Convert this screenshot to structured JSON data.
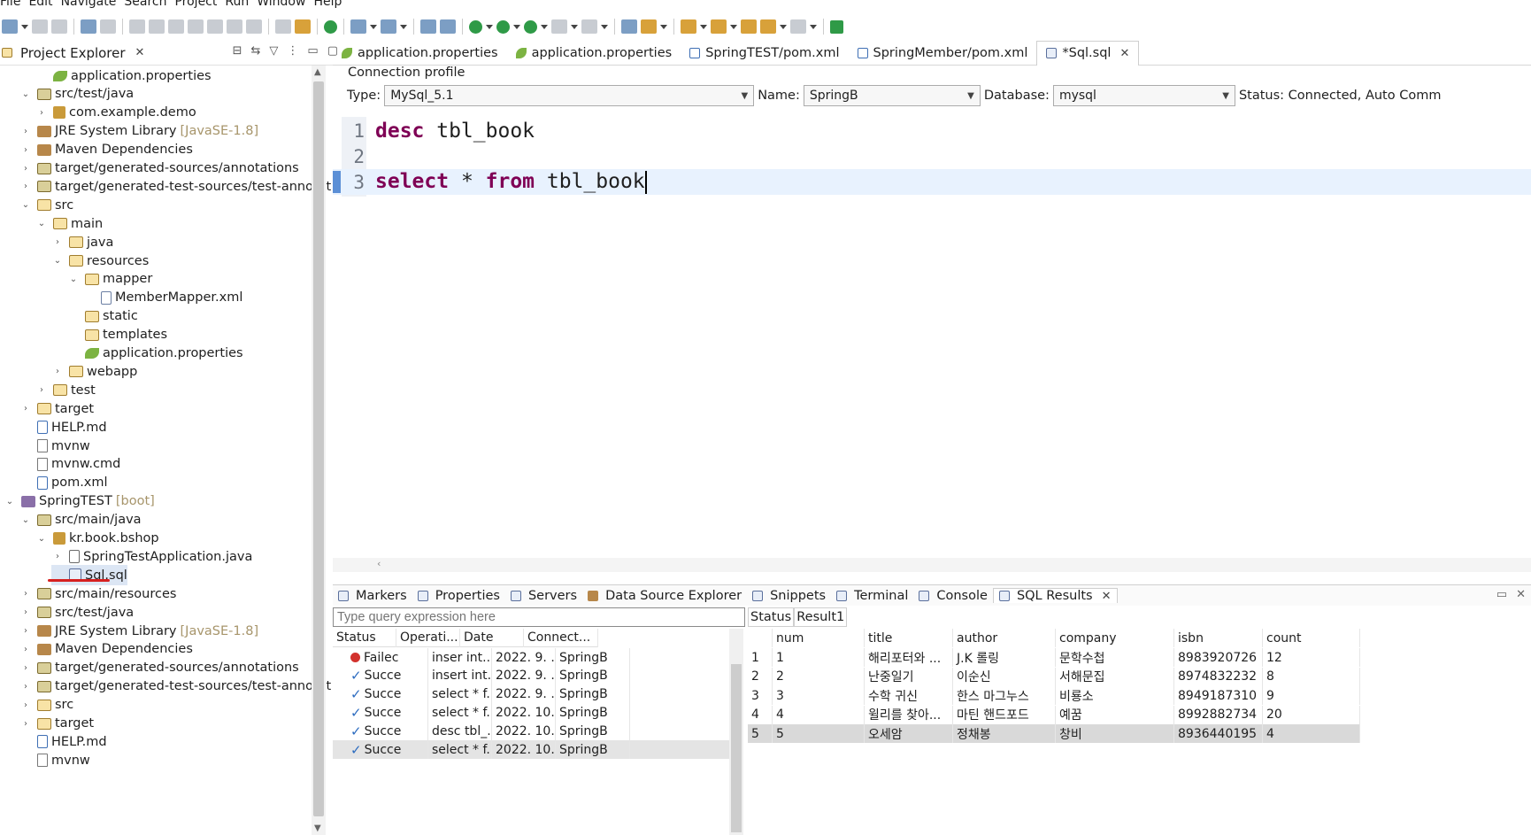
{
  "menu": [
    "File",
    "Edit",
    "Navigate",
    "Search",
    "Project",
    "Run",
    "Window",
    "Help"
  ],
  "project_explorer": {
    "title": "Project Explorer",
    "items": [
      {
        "label": "application.properties",
        "indent": 2,
        "twisty": "",
        "icon": "leaf"
      },
      {
        "label": "src/test/java",
        "indent": 1,
        "twisty": "v",
        "icon": "srcf"
      },
      {
        "label": "com.example.demo",
        "indent": 2,
        "twisty": ">",
        "icon": "pkg"
      },
      {
        "label": "JRE System Library",
        "suffix": "[JavaSE-1.8]",
        "indent": 1,
        "twisty": ">",
        "icon": "lib"
      },
      {
        "label": "Maven Dependencies",
        "indent": 1,
        "twisty": ">",
        "icon": "lib"
      },
      {
        "label": "target/generated-sources/annotations",
        "indent": 1,
        "twisty": ">",
        "icon": "srcf"
      },
      {
        "label": "target/generated-test-sources/test-annotations",
        "indent": 1,
        "twisty": ">",
        "icon": "srcf"
      },
      {
        "label": "src",
        "indent": 1,
        "twisty": "v",
        "icon": "folder"
      },
      {
        "label": "main",
        "indent": 2,
        "twisty": "v",
        "icon": "folder"
      },
      {
        "label": "java",
        "indent": 3,
        "twisty": ">",
        "icon": "folder"
      },
      {
        "label": "resources",
        "indent": 3,
        "twisty": "v",
        "icon": "folder"
      },
      {
        "label": "mapper",
        "indent": 4,
        "twisty": "v",
        "icon": "folder"
      },
      {
        "label": "MemberMapper.xml",
        "indent": 5,
        "twisty": "",
        "icon": "xml"
      },
      {
        "label": "static",
        "indent": 4,
        "twisty": "",
        "icon": "folder"
      },
      {
        "label": "templates",
        "indent": 4,
        "twisty": "",
        "icon": "folder"
      },
      {
        "label": "application.properties",
        "indent": 4,
        "twisty": "",
        "icon": "leaf"
      },
      {
        "label": "webapp",
        "indent": 3,
        "twisty": ">",
        "icon": "folder"
      },
      {
        "label": "test",
        "indent": 2,
        "twisty": ">",
        "icon": "folder"
      },
      {
        "label": "target",
        "indent": 1,
        "twisty": ">",
        "icon": "folder"
      },
      {
        "label": "HELP.md",
        "indent": 1,
        "twisty": "",
        "icon": "md"
      },
      {
        "label": "mvnw",
        "indent": 1,
        "twisty": "",
        "icon": "file"
      },
      {
        "label": "mvnw.cmd",
        "indent": 1,
        "twisty": "",
        "icon": "file"
      },
      {
        "label": "pom.xml",
        "indent": 1,
        "twisty": "",
        "icon": "md"
      },
      {
        "label": "SpringTEST",
        "suffix": "[boot]",
        "indent": 0,
        "twisty": "v",
        "icon": "proj"
      },
      {
        "label": "src/main/java",
        "indent": 1,
        "twisty": "v",
        "icon": "srcf"
      },
      {
        "label": "kr.book.bshop",
        "indent": 2,
        "twisty": "v",
        "icon": "pkg"
      },
      {
        "label": "SpringTestApplication.java",
        "indent": 3,
        "twisty": ">",
        "icon": "java"
      },
      {
        "label": "Sql.sql",
        "indent": 3,
        "twisty": "",
        "icon": "sql",
        "selected": true
      },
      {
        "label": "src/main/resources",
        "indent": 1,
        "twisty": ">",
        "icon": "srcf"
      },
      {
        "label": "src/test/java",
        "indent": 1,
        "twisty": ">",
        "icon": "srcf"
      },
      {
        "label": "JRE System Library",
        "suffix": "[JavaSE-1.8]",
        "indent": 1,
        "twisty": ">",
        "icon": "lib"
      },
      {
        "label": "Maven Dependencies",
        "indent": 1,
        "twisty": ">",
        "icon": "lib"
      },
      {
        "label": "target/generated-sources/annotations",
        "indent": 1,
        "twisty": ">",
        "icon": "srcf"
      },
      {
        "label": "target/generated-test-sources/test-annotations",
        "indent": 1,
        "twisty": ">",
        "icon": "srcf"
      },
      {
        "label": "src",
        "indent": 1,
        "twisty": ">",
        "icon": "folder"
      },
      {
        "label": "target",
        "indent": 1,
        "twisty": ">",
        "icon": "folder"
      },
      {
        "label": "HELP.md",
        "indent": 1,
        "twisty": "",
        "icon": "md"
      },
      {
        "label": "mvnw",
        "indent": 1,
        "twisty": "",
        "icon": "file"
      }
    ]
  },
  "editor_tabs": [
    {
      "label": "application.properties",
      "icon": "leaf"
    },
    {
      "label": "application.properties",
      "icon": "leaf"
    },
    {
      "label": "SpringTEST/pom.xml",
      "icon": "md"
    },
    {
      "label": "SpringMember/pom.xml",
      "icon": "md"
    },
    {
      "label": "*Sql.sql",
      "icon": "sql",
      "active": true
    }
  ],
  "connection": {
    "group_label": "Connection profile",
    "type_label": "Type:",
    "type_value": "MySql_5.1",
    "name_label": "Name:",
    "name_value": "SpringB",
    "db_label": "Database:",
    "db_value": "mysql",
    "status": "Status: Connected, Auto Comm"
  },
  "code_lines": [
    {
      "num": "1",
      "kw1": "desc",
      "rest": " tbl_book",
      "kw2": "",
      "rest2": ""
    },
    {
      "num": "2",
      "kw1": "",
      "rest": "",
      "kw2": "",
      "rest2": ""
    },
    {
      "num": "3",
      "kw1": "select",
      "rest": " * ",
      "kw2": "from",
      "rest2": " tbl_book"
    }
  ],
  "bottom_tabs": [
    "Markers",
    "Properties",
    "Servers",
    "Data Source Explorer",
    "Snippets",
    "Terminal",
    "Console",
    "SQL Results"
  ],
  "query_placeholder": "Type query expression here",
  "history": {
    "headers": [
      "Status",
      "Operati...",
      "Date",
      "Connect..."
    ],
    "rows": [
      {
        "status": "Failec",
        "ok": false,
        "op": "inser int...",
        "date": "2022. 9. ...",
        "conn": "SpringB"
      },
      {
        "status": "Succe",
        "ok": true,
        "op": "insert int...",
        "date": "2022. 9. ...",
        "conn": "SpringB"
      },
      {
        "status": "Succe",
        "ok": true,
        "op": "select * f...",
        "date": "2022. 9. ...",
        "conn": "SpringB"
      },
      {
        "status": "Succe",
        "ok": true,
        "op": "select * f...",
        "date": "2022. 10....",
        "conn": "SpringB"
      },
      {
        "status": "Succe",
        "ok": true,
        "op": "desc tbl_...",
        "date": "2022. 10....",
        "conn": "SpringB"
      },
      {
        "status": "Succe",
        "ok": true,
        "op": "select * f...",
        "date": "2022. 10....",
        "conn": "SpringB"
      }
    ]
  },
  "result_tabs": [
    "Status",
    "Result1"
  ],
  "result": {
    "headers": [
      "num",
      "title",
      "author",
      "company",
      "isbn",
      "count"
    ],
    "rows": [
      [
        "1",
        "해리포터와 ...",
        "J.K 롤링",
        "문학수첩",
        "8983920726",
        "12"
      ],
      [
        "2",
        "난중일기",
        "이순신",
        "서해문집",
        "8974832232",
        "8"
      ],
      [
        "3",
        "수학 귀신",
        "한스 마그누스",
        "비룡소",
        "8949187310",
        "9"
      ],
      [
        "4",
        "윌리를 찾아...",
        "마틴 핸드포드",
        "예꿈",
        "8992882734",
        "20"
      ],
      [
        "5",
        "오세암",
        "정채봉",
        "창비",
        "8936440195",
        "4"
      ]
    ]
  }
}
